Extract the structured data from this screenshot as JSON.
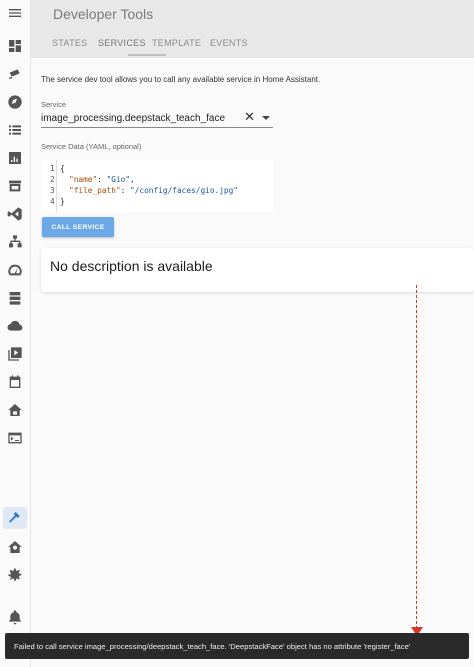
{
  "header": {
    "title": "Developer Tools",
    "tabs": [
      {
        "label": "STATES",
        "active": false
      },
      {
        "label": "SERVICES",
        "active": true
      },
      {
        "label": "TEMPLATE",
        "active": false
      },
      {
        "label": "EVENTS",
        "active": false
      }
    ]
  },
  "sidebar": {
    "items": [
      {
        "icon": "menu-icon"
      },
      {
        "icon": "dashboard-icon"
      },
      {
        "icon": "cctv-icon"
      },
      {
        "icon": "compass-icon"
      },
      {
        "icon": "list-icon"
      },
      {
        "icon": "chart-icon"
      },
      {
        "icon": "hacs-icon"
      },
      {
        "icon": "vscode-icon"
      },
      {
        "icon": "sitemap-icon"
      },
      {
        "icon": "gauge-icon"
      },
      {
        "icon": "server-icon"
      },
      {
        "icon": "cloud-icon"
      },
      {
        "icon": "media-icon"
      },
      {
        "icon": "calendar-icon"
      },
      {
        "icon": "home-icon"
      },
      {
        "icon": "terminal-icon"
      },
      {
        "icon": "hammer-icon",
        "active": true
      },
      {
        "icon": "home-gear-icon"
      },
      {
        "icon": "settings-icon"
      },
      {
        "icon": "bell-icon"
      }
    ],
    "active_color": "#dfe8f3"
  },
  "services": {
    "intro": "The service dev tool allows you to call any available service in Home Assistant.",
    "service_label": "Service",
    "service_value": "image_processing.deepstack_teach_face",
    "data_label": "Service Data (YAML, optional)",
    "code_lines": [
      {
        "num": "1",
        "text": "{"
      },
      {
        "num": "2",
        "key": "\"name\"",
        "sep": ": ",
        "val": "\"Gio\"",
        "end": ","
      },
      {
        "num": "3",
        "key": "\"file_path\"",
        "sep": ": ",
        "val": "\"/config/faces/gio.jpg\"",
        "end": ""
      },
      {
        "num": "4",
        "text": "}"
      }
    ],
    "call_button": "CALL SERVICE",
    "description": "No description is available"
  },
  "toast": {
    "message": "Failed to call service image_processing/deepstack_teach_face. 'DeepstackFace' object has no attribute 'register_face'"
  },
  "annotation": {
    "color": "#d9342b"
  },
  "colors": {
    "primary": "#6aa8e8",
    "header_bg": "#e8e8e8",
    "toast_bg": "#2a2a2a"
  }
}
